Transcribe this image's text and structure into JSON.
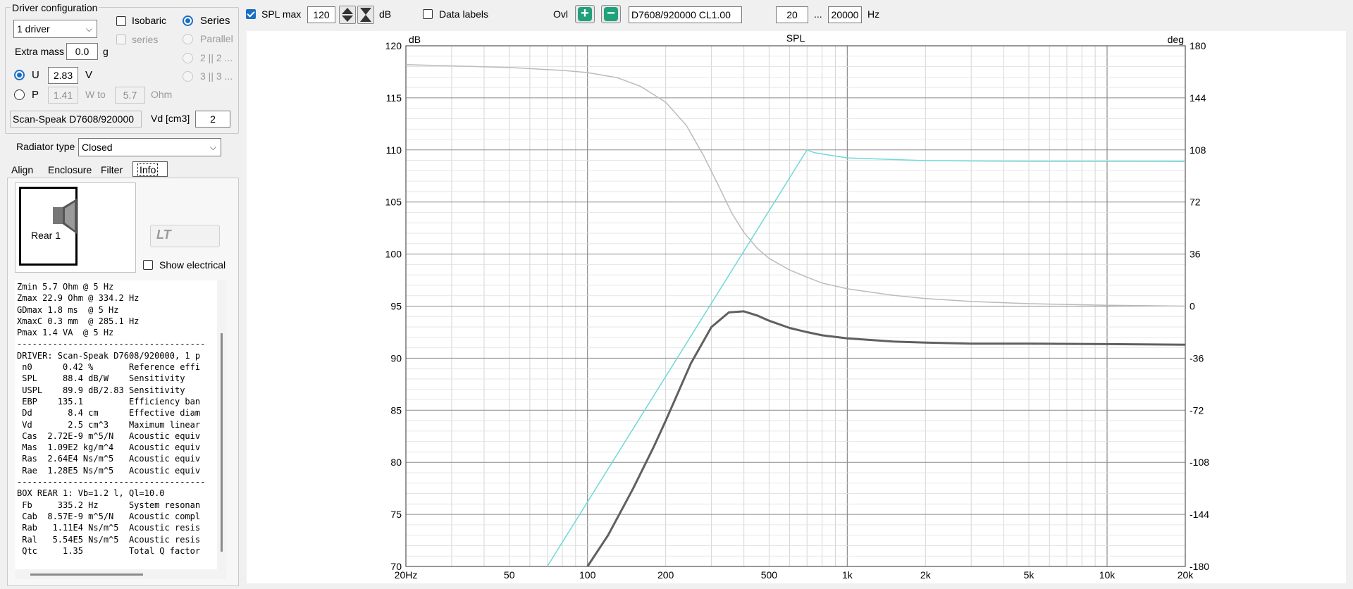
{
  "driver_config": {
    "title": "Driver configuration",
    "driver_count": "1 driver",
    "isobaric_label": "Isobaric",
    "isobaric_series_label": "series",
    "series_label": "Series",
    "parallel_label": "Parallel",
    "opt_2x2": "2 || 2 ...",
    "opt_3x3": "3 || 3 ...",
    "extra_mass_label": "Extra mass",
    "extra_mass_value": "0.0",
    "extra_mass_unit": "g",
    "u_label": "U",
    "u_value": "2.83",
    "u_unit": "V",
    "p_label": "P",
    "p_value": "1.41",
    "w_to_label": "W to",
    "ohm_value": "5.7",
    "ohm_unit": "Ohm",
    "driver_name": "Scan-Speak D7608/920000",
    "vd_label": "Vd [cm3]",
    "vd_value": "2"
  },
  "radiator": {
    "label": "Radiator type",
    "value": "Closed"
  },
  "tabs": [
    {
      "label": "Align",
      "active": false
    },
    {
      "label": "Enclosure",
      "active": false
    },
    {
      "label": "Filter",
      "active": false
    },
    {
      "label": "Info",
      "active": true
    }
  ],
  "info_panel": {
    "rear_label": "Rear 1",
    "ltspice_label": "LTspice",
    "show_electrical_label": "Show electrical",
    "text": "Zmin 5.7 Ohm @ 5 Hz\nZmax 22.9 Ohm @ 334.2 Hz\nGDmax 1.8 ms  @ 5 Hz\nXmaxC 0.3 mm  @ 285.1 Hz\nPmax 1.4 VA  @ 5 Hz\n-------------------------------------\nDRIVER: Scan-Speak D7608/920000, 1 p\n n0      0.42 %       Reference effi\n SPL     88.4 dB/W    Sensitivity\n USPL    89.9 dB/2.83 Sensitivity\n EBP    135.1         Efficiency ban\n Dd       8.4 cm      Effective diam\n Vd       2.5 cm^3    Maximum linear\n Cas  2.72E-9 m^5/N   Acoustic equiv\n Mas  1.09E2 kg/m^4   Acoustic equiv\n Ras  2.64E4 Ns/m^5   Acoustic equiv\n Rae  1.28E5 Ns/m^5   Acoustic equiv\n-------------------------------------\nBOX REAR 1: Vb=1.2 l, Ql=10.0\n Fb     335.2 Hz      System resonan\n Cab  8.57E-9 m^5/N   Acoustic compl\n Rab   1.11E4 Ns/m^5  Acoustic resis\n Ral   5.54E5 Ns/m^5  Acoustic resis\n Qtc     1.35         Total Q factor"
  },
  "toolbar": {
    "splmax_label": "SPL max",
    "splmax_value": "120",
    "db_unit": "dB",
    "data_labels": "Data labels",
    "ovl_label": "Ovl",
    "overlay_name": "D7608/920000 CL1.00",
    "freq_min": "20",
    "freq_sep": "...",
    "freq_max": "20000",
    "hz_unit": "Hz"
  },
  "chart_data": {
    "type": "line",
    "title": "SPL",
    "ylabel_left": "dB",
    "ylabel_right": "deg",
    "x_scale": "log",
    "xlim": [
      20,
      20000
    ],
    "ylim": [
      70,
      120
    ],
    "y2lim": [
      -180,
      180
    ],
    "x_ticks": [
      {
        "v": 20,
        "label": "20Hz"
      },
      {
        "v": 50,
        "label": "50"
      },
      {
        "v": 100,
        "label": "100"
      },
      {
        "v": 200,
        "label": "200"
      },
      {
        "v": 500,
        "label": "500"
      },
      {
        "v": 1000,
        "label": "1k"
      },
      {
        "v": 2000,
        "label": "2k"
      },
      {
        "v": 5000,
        "label": "5k"
      },
      {
        "v": 10000,
        "label": "10k"
      },
      {
        "v": 20000,
        "label": "20k"
      }
    ],
    "y_ticks": [
      "70",
      "75",
      "80",
      "85",
      "90",
      "95",
      "100",
      "105",
      "110",
      "115",
      "120"
    ],
    "y2_ticks": [
      "-180",
      "-144",
      "-108",
      "-72",
      "-36",
      "0",
      "36",
      "72",
      "108",
      "144",
      "180"
    ],
    "grid": true,
    "series": [
      {
        "axis": "left",
        "color": "#606060",
        "width": 3,
        "x": [
          100,
          120,
          150,
          180,
          200,
          250,
          300,
          350,
          400,
          450,
          500,
          600,
          700,
          800,
          1000,
          1500,
          2000,
          3000,
          5000,
          10000,
          20000
        ],
        "y": [
          70,
          73,
          77.5,
          81.5,
          84,
          89.5,
          93,
          94.4,
          94.5,
          94.1,
          93.6,
          92.9,
          92.5,
          92.2,
          91.9,
          91.6,
          91.5,
          91.4,
          91.4,
          91.35,
          91.3
        ]
      },
      {
        "axis": "right",
        "color": "#6fd9d6",
        "width": 1.5,
        "x": [
          70,
          700,
          750,
          1000,
          2000,
          5000,
          20000
        ],
        "y": [
          -180,
          108,
          106,
          102.5,
          100.6,
          100.1,
          100
        ]
      },
      {
        "axis": "right",
        "color": "#bbbbbb",
        "width": 1.5,
        "x": [
          20,
          50,
          80,
          100,
          130,
          160,
          200,
          240,
          280,
          320,
          360,
          400,
          450,
          500,
          600,
          700,
          800,
          1000,
          1500,
          2000,
          3000,
          5000,
          10000,
          20000
        ],
        "y": [
          167,
          165,
          163,
          161.5,
          158,
          152,
          141,
          125,
          104,
          83,
          64,
          51,
          40,
          33,
          25,
          20,
          16,
          12,
          7.5,
          5.2,
          3.2,
          1.7,
          0.6,
          0
        ]
      }
    ]
  }
}
